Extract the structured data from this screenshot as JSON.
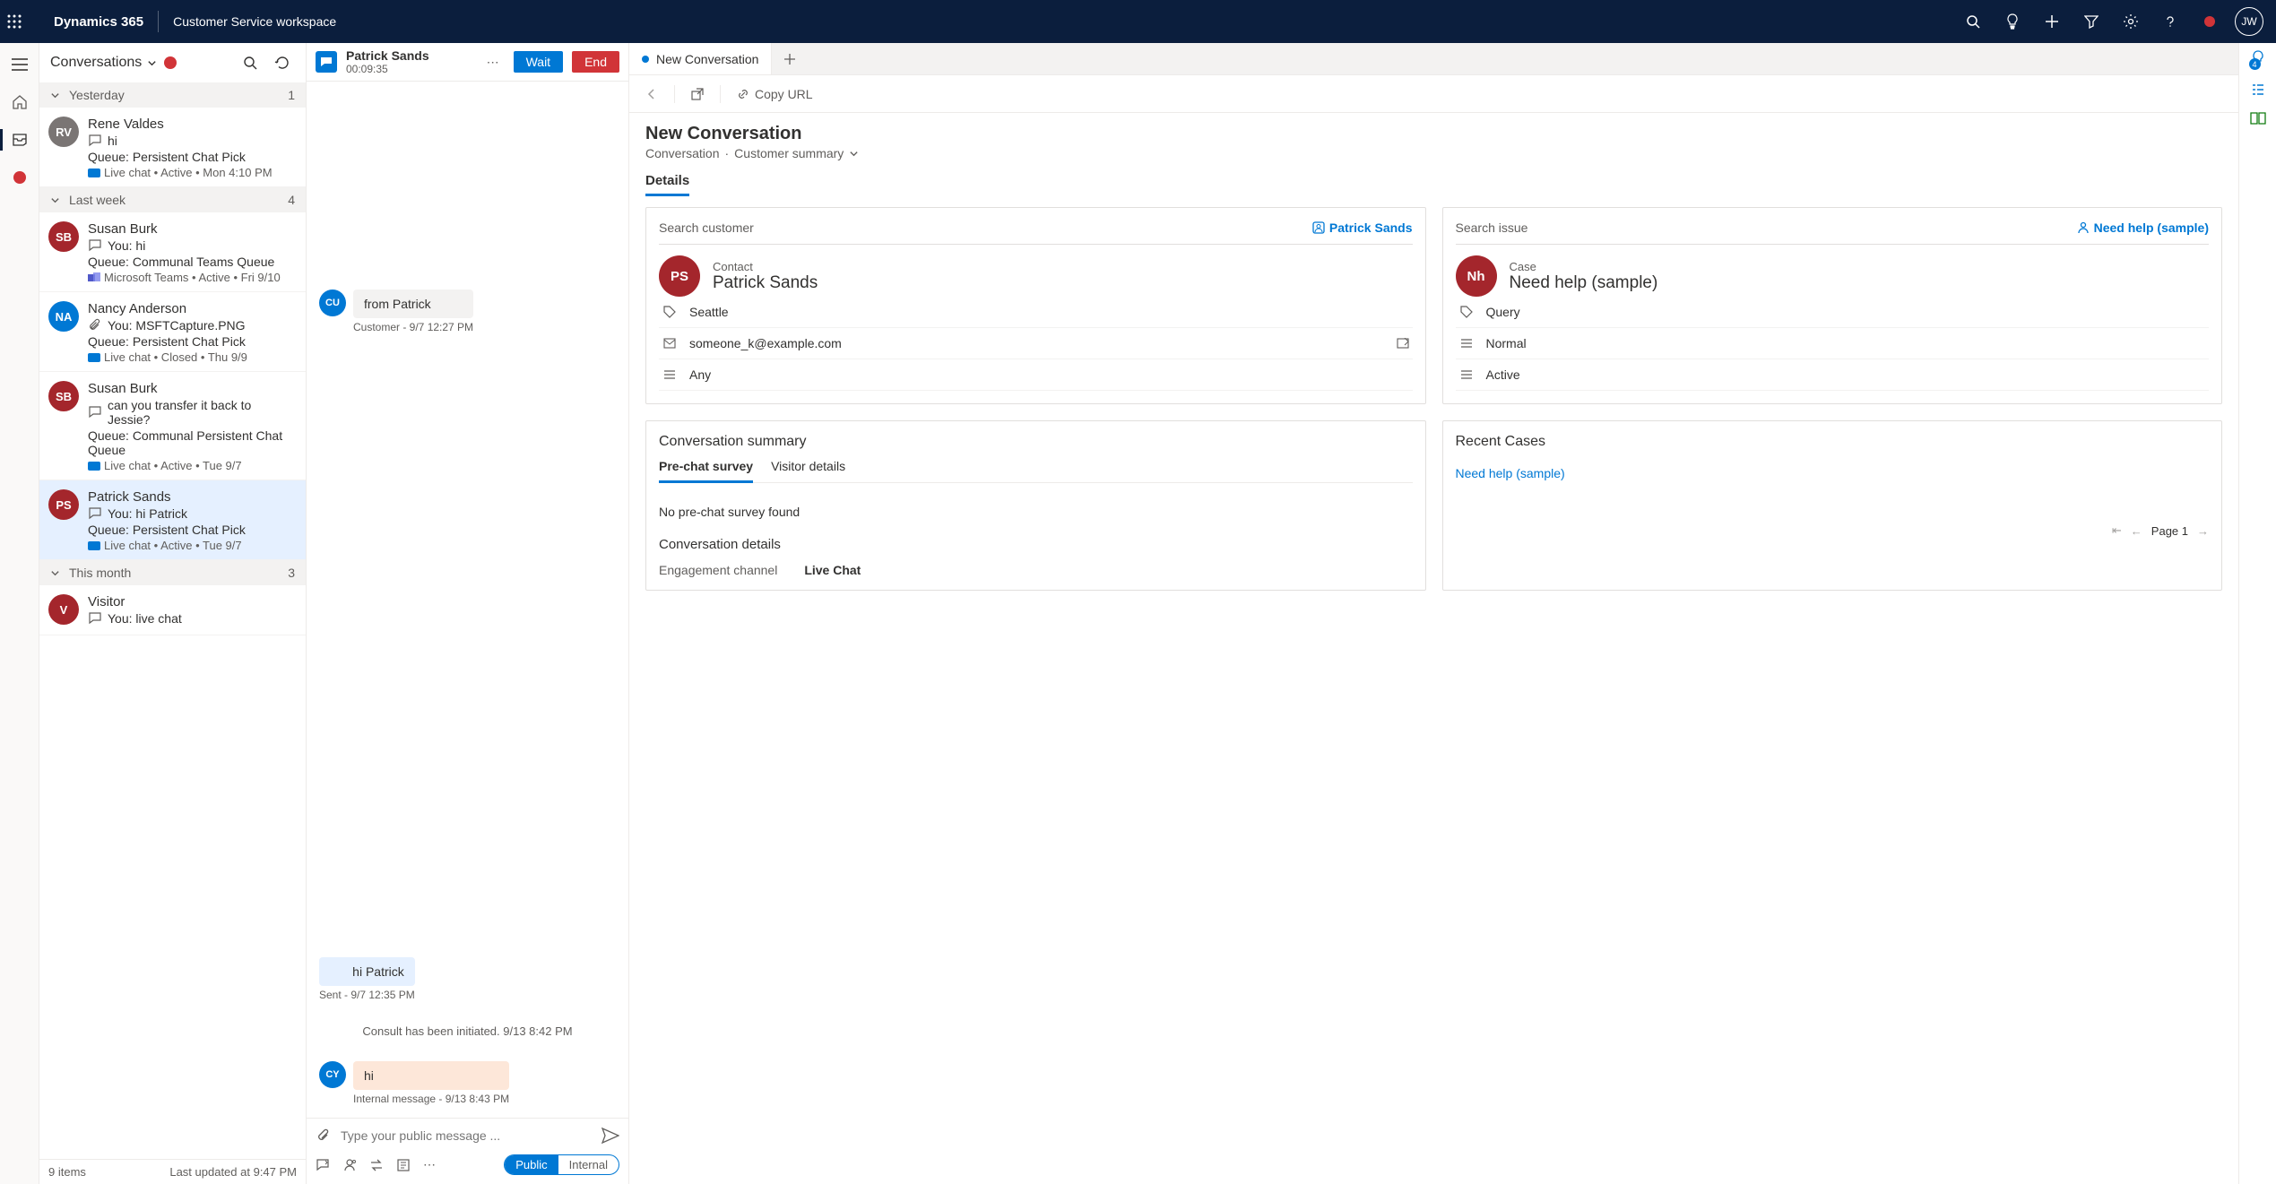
{
  "topbar": {
    "brand": "Dynamics 365",
    "workspace": "Customer Service workspace",
    "avatar_initials": "JW"
  },
  "conv_panel": {
    "title": "Conversations",
    "groups": [
      {
        "label": "Yesterday",
        "count": "1"
      },
      {
        "label": "Last week",
        "count": "4"
      },
      {
        "label": "This month",
        "count": "3"
      }
    ],
    "items": {
      "rene": {
        "initials": "RV",
        "color": "#7a7574",
        "name": "Rene Valdes",
        "preview": "hi",
        "queue": "Queue: Persistent Chat Pick",
        "meta": "Live chat  •  Active  •  Mon 4:10 PM"
      },
      "susan1": {
        "initials": "SB",
        "color": "#a4262c",
        "name": "Susan Burk",
        "preview": "You: hi",
        "queue": "Queue: Communal Teams Queue",
        "meta": "Microsoft Teams  •  Active  •  Fri 9/10"
      },
      "nancy": {
        "initials": "NA",
        "color": "#0078d4",
        "name": "Nancy Anderson",
        "preview": "You: MSFTCapture.PNG",
        "queue": "Queue: Persistent Chat Pick",
        "meta": "Live chat  •  Closed  •  Thu 9/9"
      },
      "susan2": {
        "initials": "SB",
        "color": "#a4262c",
        "name": "Susan Burk",
        "preview": "can you transfer it back to Jessie?",
        "queue": "Queue: Communal Persistent Chat Queue",
        "meta": "Live chat  •  Active  •  Tue 9/7"
      },
      "patrick": {
        "initials": "PS",
        "color": "#a4262c",
        "name": "Patrick Sands",
        "preview": "You: hi Patrick",
        "queue": "Queue: Persistent Chat Pick",
        "meta": "Live chat  •  Active  •  Tue 9/7"
      },
      "visitor": {
        "initials": "V",
        "color": "#a4262c",
        "name": "Visitor",
        "preview": "You: live chat"
      }
    },
    "footer_count": "9 items",
    "footer_updated": "Last updated at 9:47 PM"
  },
  "chat": {
    "name": "Patrick Sands",
    "timer": "00:09:35",
    "wait": "Wait",
    "end": "End",
    "msgs": {
      "m1": {
        "av": "CU",
        "text": "from Patrick",
        "meta": "Customer - 9/7 12:27 PM"
      },
      "m2": {
        "text": "hi Patrick",
        "meta": "Sent - 9/7 12:35 PM"
      },
      "sys": "Consult has been initiated. 9/13 8:42 PM",
      "m3": {
        "av": "CY",
        "text": "hi",
        "meta": "Internal message - 9/13 8:43 PM"
      }
    },
    "compose_placeholder": "Type your public message ...",
    "toggle": {
      "public": "Public",
      "internal": "Internal"
    }
  },
  "right": {
    "tab_label": "New Conversation",
    "copy_url": "Copy URL",
    "heading": "New Conversation",
    "crumb1": "Conversation",
    "crumb2": "Customer summary",
    "details_tab": "Details",
    "customer_card": {
      "search": "Search customer",
      "lookup": "Patrick Sands",
      "type": "Contact",
      "name": "Patrick Sands",
      "city": "Seattle",
      "email": "someone_k@example.com",
      "pref": "Any"
    },
    "case_card": {
      "search": "Search issue",
      "lookup": "Need help (sample)",
      "av": "Nh",
      "type": "Case",
      "name": "Need help (sample)",
      "f1": "Query",
      "f2": "Normal",
      "f3": "Active"
    },
    "summary_card": {
      "title": "Conversation summary",
      "tab1": "Pre-chat survey",
      "tab2": "Visitor details",
      "empty": "No pre-chat survey found",
      "details_hdr": "Conversation details",
      "channel_label": "Engagement channel",
      "channel_value": "Live Chat"
    },
    "recent_card": {
      "title": "Recent Cases",
      "link": "Need help (sample)",
      "page": "Page 1"
    }
  },
  "right_rail": {
    "badge": "4"
  }
}
